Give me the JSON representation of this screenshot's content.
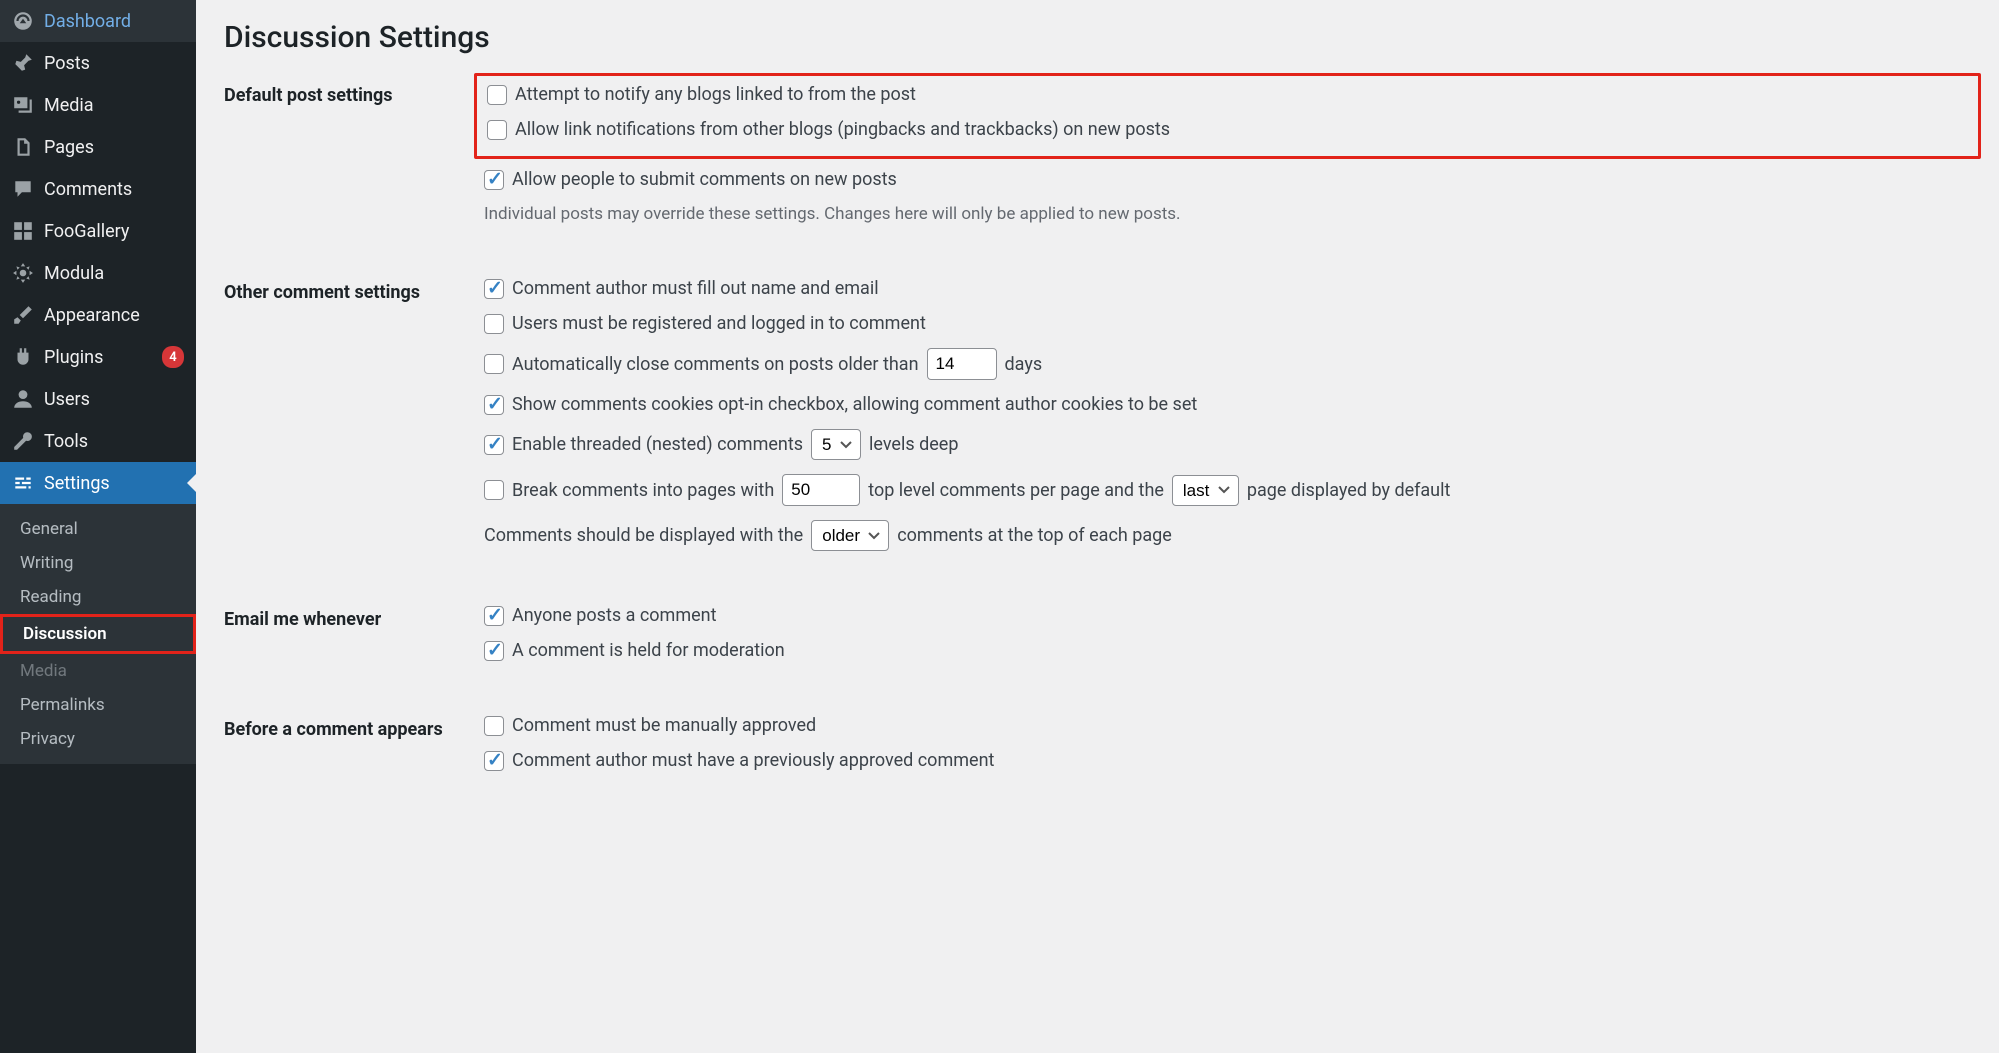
{
  "sidebar": {
    "items": [
      {
        "label": "Dashboard",
        "icon": "dashboard"
      },
      {
        "label": "Posts",
        "icon": "pin"
      },
      {
        "label": "Media",
        "icon": "media"
      },
      {
        "label": "Pages",
        "icon": "pages"
      },
      {
        "label": "Comments",
        "icon": "comment"
      },
      {
        "label": "FooGallery",
        "icon": "gallery"
      },
      {
        "label": "Modula",
        "icon": "modula"
      },
      {
        "label": "Appearance",
        "icon": "brush"
      },
      {
        "label": "Plugins",
        "icon": "plugin",
        "badge": "4"
      },
      {
        "label": "Users",
        "icon": "user"
      },
      {
        "label": "Tools",
        "icon": "wrench"
      },
      {
        "label": "Settings",
        "icon": "settings"
      }
    ],
    "submenu": [
      {
        "label": "General"
      },
      {
        "label": "Writing"
      },
      {
        "label": "Reading"
      },
      {
        "label": "Discussion"
      },
      {
        "label": "Media"
      },
      {
        "label": "Permalinks"
      },
      {
        "label": "Privacy"
      }
    ]
  },
  "page": {
    "title": "Discussion Settings",
    "sections": {
      "default_post": {
        "heading": "Default post settings",
        "notify_blogs": "Attempt to notify any blogs linked to from the post",
        "allow_pingbacks": "Allow link notifications from other blogs (pingbacks and trackbacks) on new posts",
        "allow_comments": "Allow people to submit comments on new posts",
        "note": "Individual posts may override these settings. Changes here will only be applied to new posts."
      },
      "other_comment": {
        "heading": "Other comment settings",
        "fill_name_email": "Comment author must fill out name and email",
        "must_register": "Users must be registered and logged in to comment",
        "auto_close_pre": "Automatically close comments on posts older than",
        "auto_close_days_value": "14",
        "auto_close_post": "days",
        "cookies_optin": "Show comments cookies opt-in checkbox, allowing comment author cookies to be set",
        "threaded_pre": "Enable threaded (nested) comments",
        "threaded_levels": "5",
        "threaded_post": "levels deep",
        "break_pre": "Break comments into pages with",
        "break_per_page_value": "50",
        "break_mid": "top level comments per page and the",
        "break_page_order": "last",
        "break_post": "page displayed by default",
        "display_pre": "Comments should be displayed with the",
        "display_order": "older",
        "display_post": "comments at the top of each page"
      },
      "email_me": {
        "heading": "Email me whenever",
        "anyone_posts": "Anyone posts a comment",
        "held_moderation": "A comment is held for moderation"
      },
      "before_appears": {
        "heading": "Before a comment appears",
        "manually_approved": "Comment must be manually approved",
        "prev_approved": "Comment author must have a previously approved comment"
      }
    }
  }
}
